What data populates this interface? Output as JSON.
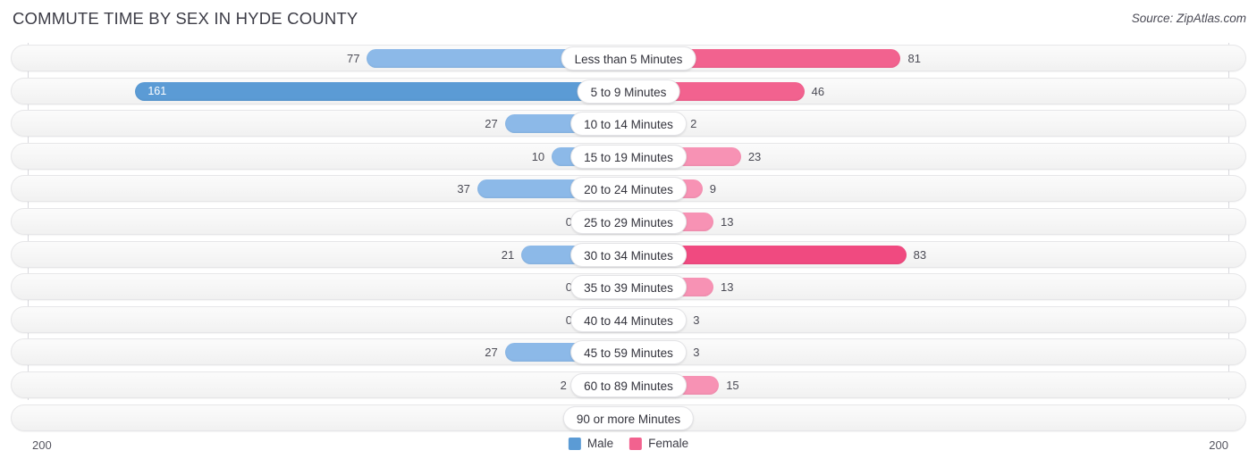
{
  "header": {
    "title": "COMMUTE TIME BY SEX IN HYDE COUNTY",
    "source": "Source: ZipAtlas.com"
  },
  "axis": {
    "left_max": "200",
    "right_max": "200"
  },
  "legend": [
    {
      "label": "Male",
      "color": "#5b9bd5"
    },
    {
      "label": "Female",
      "color": "#f2628f"
    }
  ],
  "chart_data": {
    "type": "bar",
    "title": "COMMUTE TIME BY SEX IN HYDE COUNTY",
    "subtitle": "Source: ZipAtlas.com",
    "orientation": "horizontal-diverging",
    "xlabel": "",
    "ylabel": "",
    "xlim": [
      200,
      200
    ],
    "axis_max": 200,
    "grid": false,
    "legend_position": "bottom-center",
    "categories": [
      "Less than 5 Minutes",
      "5 to 9 Minutes",
      "10 to 14 Minutes",
      "15 to 19 Minutes",
      "20 to 24 Minutes",
      "25 to 29 Minutes",
      "30 to 34 Minutes",
      "35 to 39 Minutes",
      "40 to 44 Minutes",
      "45 to 59 Minutes",
      "60 to 89 Minutes",
      "90 or more Minutes"
    ],
    "series": [
      {
        "name": "Male",
        "color": "#8cb9e8",
        "peak_color": "#5b9bd5",
        "values": [
          77,
          161,
          27,
          10,
          37,
          0,
          21,
          0,
          0,
          27,
          2,
          0
        ]
      },
      {
        "name": "Female",
        "color": "#f792b4",
        "peak_color": "#f04a80",
        "values": [
          81,
          46,
          2,
          23,
          9,
          13,
          83,
          13,
          3,
          3,
          15,
          0
        ]
      }
    ]
  },
  "rows": [
    {
      "label": "Less than 5 Minutes",
      "male": "77",
      "female": "81"
    },
    {
      "label": "5 to 9 Minutes",
      "male": "161",
      "female": "46"
    },
    {
      "label": "10 to 14 Minutes",
      "male": "27",
      "female": "2"
    },
    {
      "label": "15 to 19 Minutes",
      "male": "10",
      "female": "23"
    },
    {
      "label": "20 to 24 Minutes",
      "male": "37",
      "female": "9"
    },
    {
      "label": "25 to 29 Minutes",
      "male": "0",
      "female": "13"
    },
    {
      "label": "30 to 34 Minutes",
      "male": "21",
      "female": "83"
    },
    {
      "label": "35 to 39 Minutes",
      "male": "0",
      "female": "13"
    },
    {
      "label": "40 to 44 Minutes",
      "male": "0",
      "female": "3"
    },
    {
      "label": "45 to 59 Minutes",
      "male": "27",
      "female": "3"
    },
    {
      "label": "60 to 89 Minutes",
      "male": "2",
      "female": "15"
    },
    {
      "label": "90 or more Minutes",
      "male": "0",
      "female": "0"
    }
  ]
}
